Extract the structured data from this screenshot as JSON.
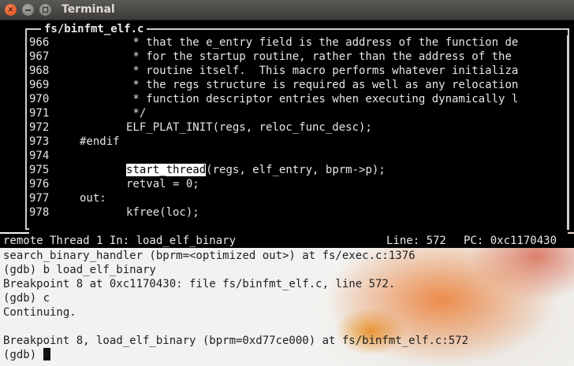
{
  "window": {
    "title": "Terminal",
    "close_glyph": "×"
  },
  "source": {
    "file": "fs/binfmt_elf.c",
    "highlight_word": "start_thread",
    "lines": [
      {
        "num": "966",
        "text": "        * that the e_entry field is the address of the function de"
      },
      {
        "num": "967",
        "text": "        * for the startup routine, rather than the address of the"
      },
      {
        "num": "968",
        "text": "        * routine itself.  This macro performs whatever initializa"
      },
      {
        "num": "969",
        "text": "        * the regs structure is required as well as any relocation"
      },
      {
        "num": "970",
        "text": "        * function descriptor entries when executing dynamically l"
      },
      {
        "num": "971",
        "text": "        */"
      },
      {
        "num": "972",
        "text": "       ELF_PLAT_INIT(regs, reloc_func_desc);"
      },
      {
        "num": "973",
        "text": "#endif"
      },
      {
        "num": "974",
        "text": ""
      },
      {
        "num": "975",
        "text": "       ",
        "highlight": "start_thread",
        "rest": "(regs, elf_entry, bprm->p);"
      },
      {
        "num": "976",
        "text": "       retval = 0;"
      },
      {
        "num": "977",
        "text": "out:"
      },
      {
        "num": "978",
        "text": "       kfree(loc);"
      }
    ]
  },
  "status": {
    "left": "remote Thread 1 In: load_elf_binary",
    "line": "Line: 572",
    "pc": "PC: 0xc1170430"
  },
  "console": {
    "lines": [
      "search_binary_handler (bprm=<optimized out>) at fs/exec.c:1376",
      "(gdb) b load_elf_binary",
      "Breakpoint 8 at 0xc1170430: file fs/binfmt_elf.c, line 572.",
      "(gdb) c",
      "Continuing.",
      "",
      "Breakpoint 8, load_elf_binary (bprm=0xd77ce000) at fs/binfmt_elf.c:572"
    ],
    "prompt": "(gdb) "
  },
  "colors": {
    "titlebar": "#3c3b37",
    "close_button": "#df4a16",
    "terminal_bg": "#f3f2f0",
    "source_bg": "#000000",
    "text_dark": "#202020"
  }
}
